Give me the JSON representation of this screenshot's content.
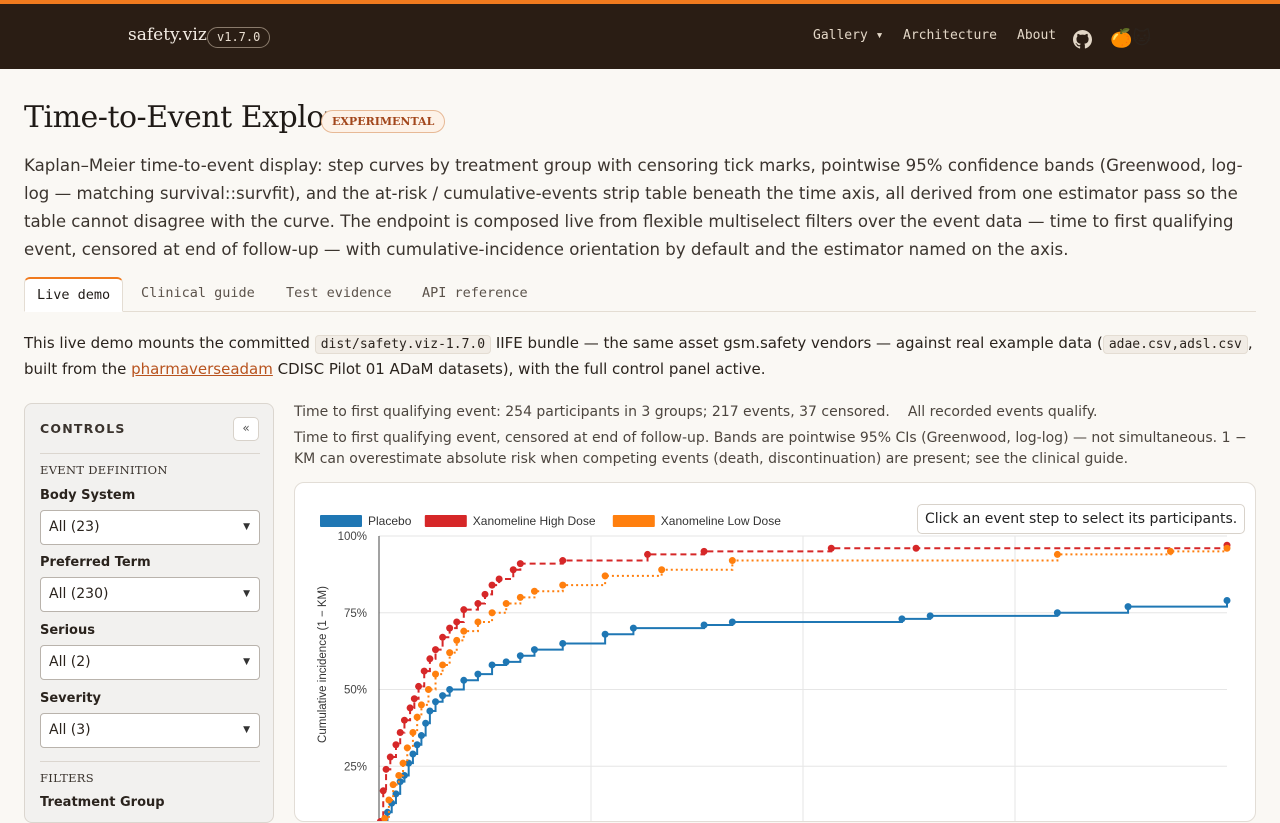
{
  "app": {
    "brand": "safety.viz",
    "version": "v1.7.0",
    "nav": {
      "gallery": "Gallery ▾",
      "architecture": "Architecture",
      "about": "About"
    },
    "mascot": "🍊🐱"
  },
  "header": {
    "title": "Time-to-Event Explorer",
    "badge": "EXPERIMENTAL",
    "lead": "Kaplan–Meier time-to-event display: step curves by treatment group with censoring tick marks, pointwise 95% confidence bands (Greenwood, log-log — matching survival::survfit), and the at-risk / cumulative-events strip table beneath the time axis, all derived from one estimator pass so the table cannot disagree with the curve. The endpoint is composed live from flexible multiselect filters over the event data — time to first qualifying event, censored at end of follow-up — with cumulative-incidence orientation by default and the estimator named on the axis."
  },
  "tabs": [
    "Live demo",
    "Clinical guide",
    "Test evidence",
    "API reference"
  ],
  "intro": {
    "p1": "This live demo mounts the committed ",
    "bundle": "dist/safety.viz-1.7.0",
    "p2": " IIFE bundle — the same asset gsm.safety vendors — against real example data (",
    "datafiles": "adae.csv,adsl.csv",
    "p3": ",",
    "p4": "built from the ",
    "link": "pharmaverseadam",
    "p5": " CDISC Pilot 01 ADaM datasets), with the full control panel active."
  },
  "controls": {
    "title": "CONTROLS",
    "collapse": "«",
    "event_section": "EVENT DEFINITION",
    "fields": [
      {
        "label": "Body System",
        "value": "All (23)"
      },
      {
        "label": "Preferred Term",
        "value": "All (230)"
      },
      {
        "label": "Serious",
        "value": "All (2)"
      },
      {
        "label": "Severity",
        "value": "All (3)"
      }
    ],
    "filters_section": "FILTERS",
    "next_label": "Treatment Group"
  },
  "summary": {
    "line1": "Time to first qualifying event: 254 participants in 3 groups; 217 events, 37 censored.",
    "line1b": "All recorded events qualify.",
    "line2": "Time to first qualifying event, censored at end of follow-up. Bands are pointwise 95% CIs (Greenwood, log-log) — not simultaneous. 1 − KM can overestimate absolute risk when competing events (death, discontinuation) are present; see the clinical guide."
  },
  "chart_hint": "Click an event step to select its participants.",
  "chart_data": {
    "type": "line",
    "step": true,
    "ylabel": "Cumulative incidence (1 − KM)",
    "ylim": [
      0,
      1
    ],
    "yticks": [
      "25%",
      "50%",
      "75%",
      "100%"
    ],
    "legend_position": "top-left",
    "series": [
      {
        "name": "Placebo",
        "color": "#1f77b4",
        "style": "solid",
        "x": [
          0,
          1,
          3,
          6,
          9,
          12,
          15,
          18,
          21,
          24,
          27,
          30,
          33,
          36,
          40,
          45,
          50,
          60,
          70,
          80,
          90,
          100,
          110,
          130,
          160,
          180,
          230,
          250,
          370,
          390,
          480,
          530,
          600
        ],
        "y": [
          0.0,
          0.03,
          0.06,
          0.1,
          0.13,
          0.16,
          0.2,
          0.22,
          0.26,
          0.29,
          0.32,
          0.35,
          0.39,
          0.43,
          0.46,
          0.48,
          0.5,
          0.53,
          0.55,
          0.58,
          0.59,
          0.61,
          0.63,
          0.65,
          0.68,
          0.7,
          0.71,
          0.72,
          0.73,
          0.74,
          0.75,
          0.77,
          0.79
        ]
      },
      {
        "name": "Xanomeline High Dose",
        "color": "#d62728",
        "style": "dashed",
        "x": [
          0,
          1,
          3,
          5,
          8,
          12,
          15,
          18,
          22,
          25,
          28,
          32,
          36,
          40,
          45,
          50,
          55,
          60,
          70,
          75,
          80,
          85,
          95,
          100,
          130,
          190,
          230,
          320,
          380,
          600
        ],
        "y": [
          0.0,
          0.07,
          0.17,
          0.24,
          0.28,
          0.32,
          0.36,
          0.4,
          0.44,
          0.47,
          0.51,
          0.56,
          0.6,
          0.63,
          0.67,
          0.7,
          0.72,
          0.76,
          0.78,
          0.81,
          0.84,
          0.86,
          0.89,
          0.91,
          0.92,
          0.94,
          0.95,
          0.96,
          0.96,
          0.97
        ]
      },
      {
        "name": "Xanomeline Low Dose",
        "color": "#ff7f0e",
        "style": "dotted",
        "x": [
          0,
          1,
          4,
          7,
          10,
          14,
          17,
          20,
          24,
          27,
          30,
          35,
          40,
          45,
          50,
          55,
          60,
          70,
          80,
          90,
          100,
          110,
          130,
          160,
          200,
          250,
          480,
          560,
          600
        ],
        "y": [
          0.0,
          0.03,
          0.08,
          0.14,
          0.19,
          0.22,
          0.26,
          0.31,
          0.36,
          0.41,
          0.45,
          0.5,
          0.55,
          0.58,
          0.62,
          0.66,
          0.69,
          0.72,
          0.75,
          0.78,
          0.8,
          0.82,
          0.84,
          0.87,
          0.89,
          0.92,
          0.94,
          0.95,
          0.96
        ]
      }
    ]
  }
}
